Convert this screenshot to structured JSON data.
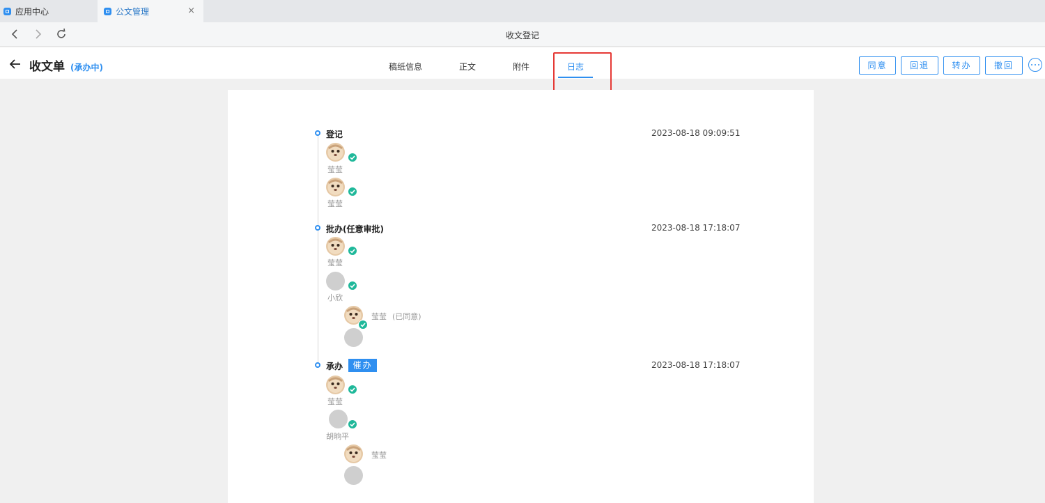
{
  "browser": {
    "tabs": [
      {
        "label": "应用中心",
        "active": false
      },
      {
        "label": "公文管理",
        "active": true
      }
    ],
    "close_symbol": "×",
    "page_title": "收文登记"
  },
  "header": {
    "title": "收文单",
    "status": "(承办中)",
    "tabs": [
      "稿纸信息",
      "正文",
      "附件",
      "日志"
    ],
    "active_tab": "日志",
    "actions": [
      "同意",
      "回退",
      "转办",
      "撤回"
    ],
    "more_icon": "ellipsis-circle-icon"
  },
  "log": {
    "steps": [
      {
        "title": "登记",
        "time": "2023-08-18 09:09:51",
        "users": [
          {
            "name": "莹莹",
            "done": true
          },
          {
            "name": "莹莹",
            "done": true
          }
        ]
      },
      {
        "title": "批办(任意审批)",
        "time": "2023-08-18 17:18:07",
        "users": [
          {
            "name": "莹莹",
            "done": true
          },
          {
            "name": "小欣",
            "done": true
          }
        ],
        "delegate": {
          "name": "莹莹",
          "note": "(已同意)"
        }
      },
      {
        "title": "承办",
        "time": "2023-08-18 17:18:07",
        "urge_label": "催办",
        "users": [
          {
            "name": "莹莹",
            "done": true
          },
          {
            "name": "胡晌平",
            "done": true
          }
        ],
        "delegate": {
          "name": "莹莹"
        }
      }
    ]
  },
  "colors": {
    "accent": "#2f8ff0",
    "success": "#1fb89a",
    "highlight": "#e53935"
  }
}
